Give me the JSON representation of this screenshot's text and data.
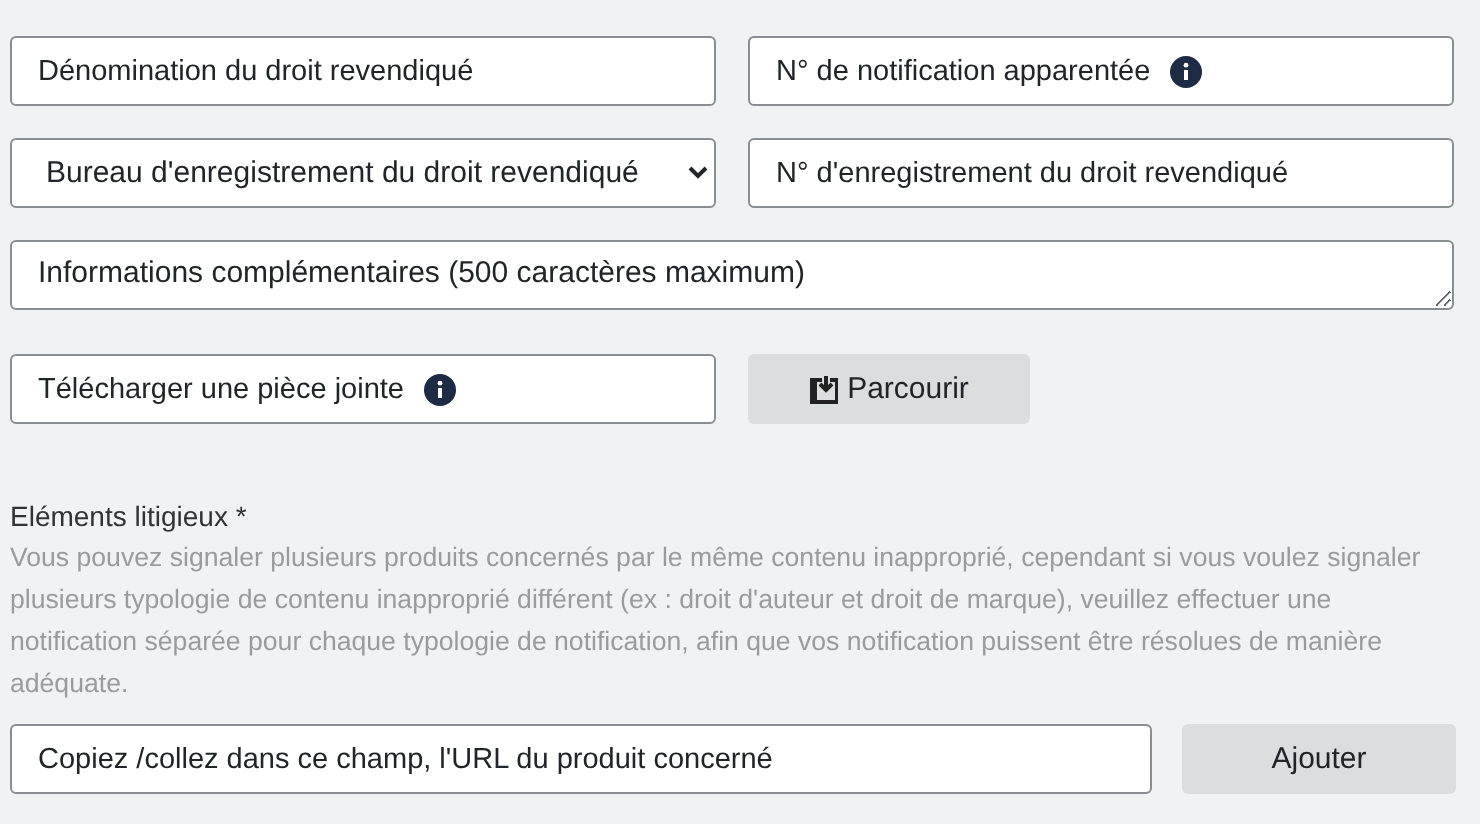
{
  "fields_row_1": [
    {
      "kind": "input",
      "placeholder": "Dénomination du droit revendiqué",
      "info": false
    },
    {
      "kind": "input",
      "placeholder": "N° de notification apparentée",
      "info": true
    }
  ],
  "fields_row_2": [
    {
      "kind": "select",
      "value": "Bureau d'enregistrement du droit revendiqué"
    },
    {
      "kind": "input",
      "placeholder": "N° d'enregistrement du droit revendiqué",
      "info": false
    }
  ],
  "additional_info": {
    "placeholder": "Informations complémentaires (500 caractères maximum)"
  },
  "attachment": {
    "placeholder": "Télécharger une pièce jointe",
    "info": true,
    "button": "Parcourir"
  },
  "disputed_items": {
    "label": "Eléments litigieux *",
    "help": "Vous pouvez signaler plusieurs produits concernés par le même contenu inapproprié, cependant si vous voulez signaler plusieurs typologie de contenu inapproprié différent (ex : droit d'auteur et droit de marque), veuillez effectuer une notification séparée pour chaque typologie de notification, afin que vos notification puissent être résolues de manière adéquate.",
    "url_placeholder": "Copiez /collez dans ce champ, l'URL du produit concerné",
    "button": "Ajouter"
  }
}
